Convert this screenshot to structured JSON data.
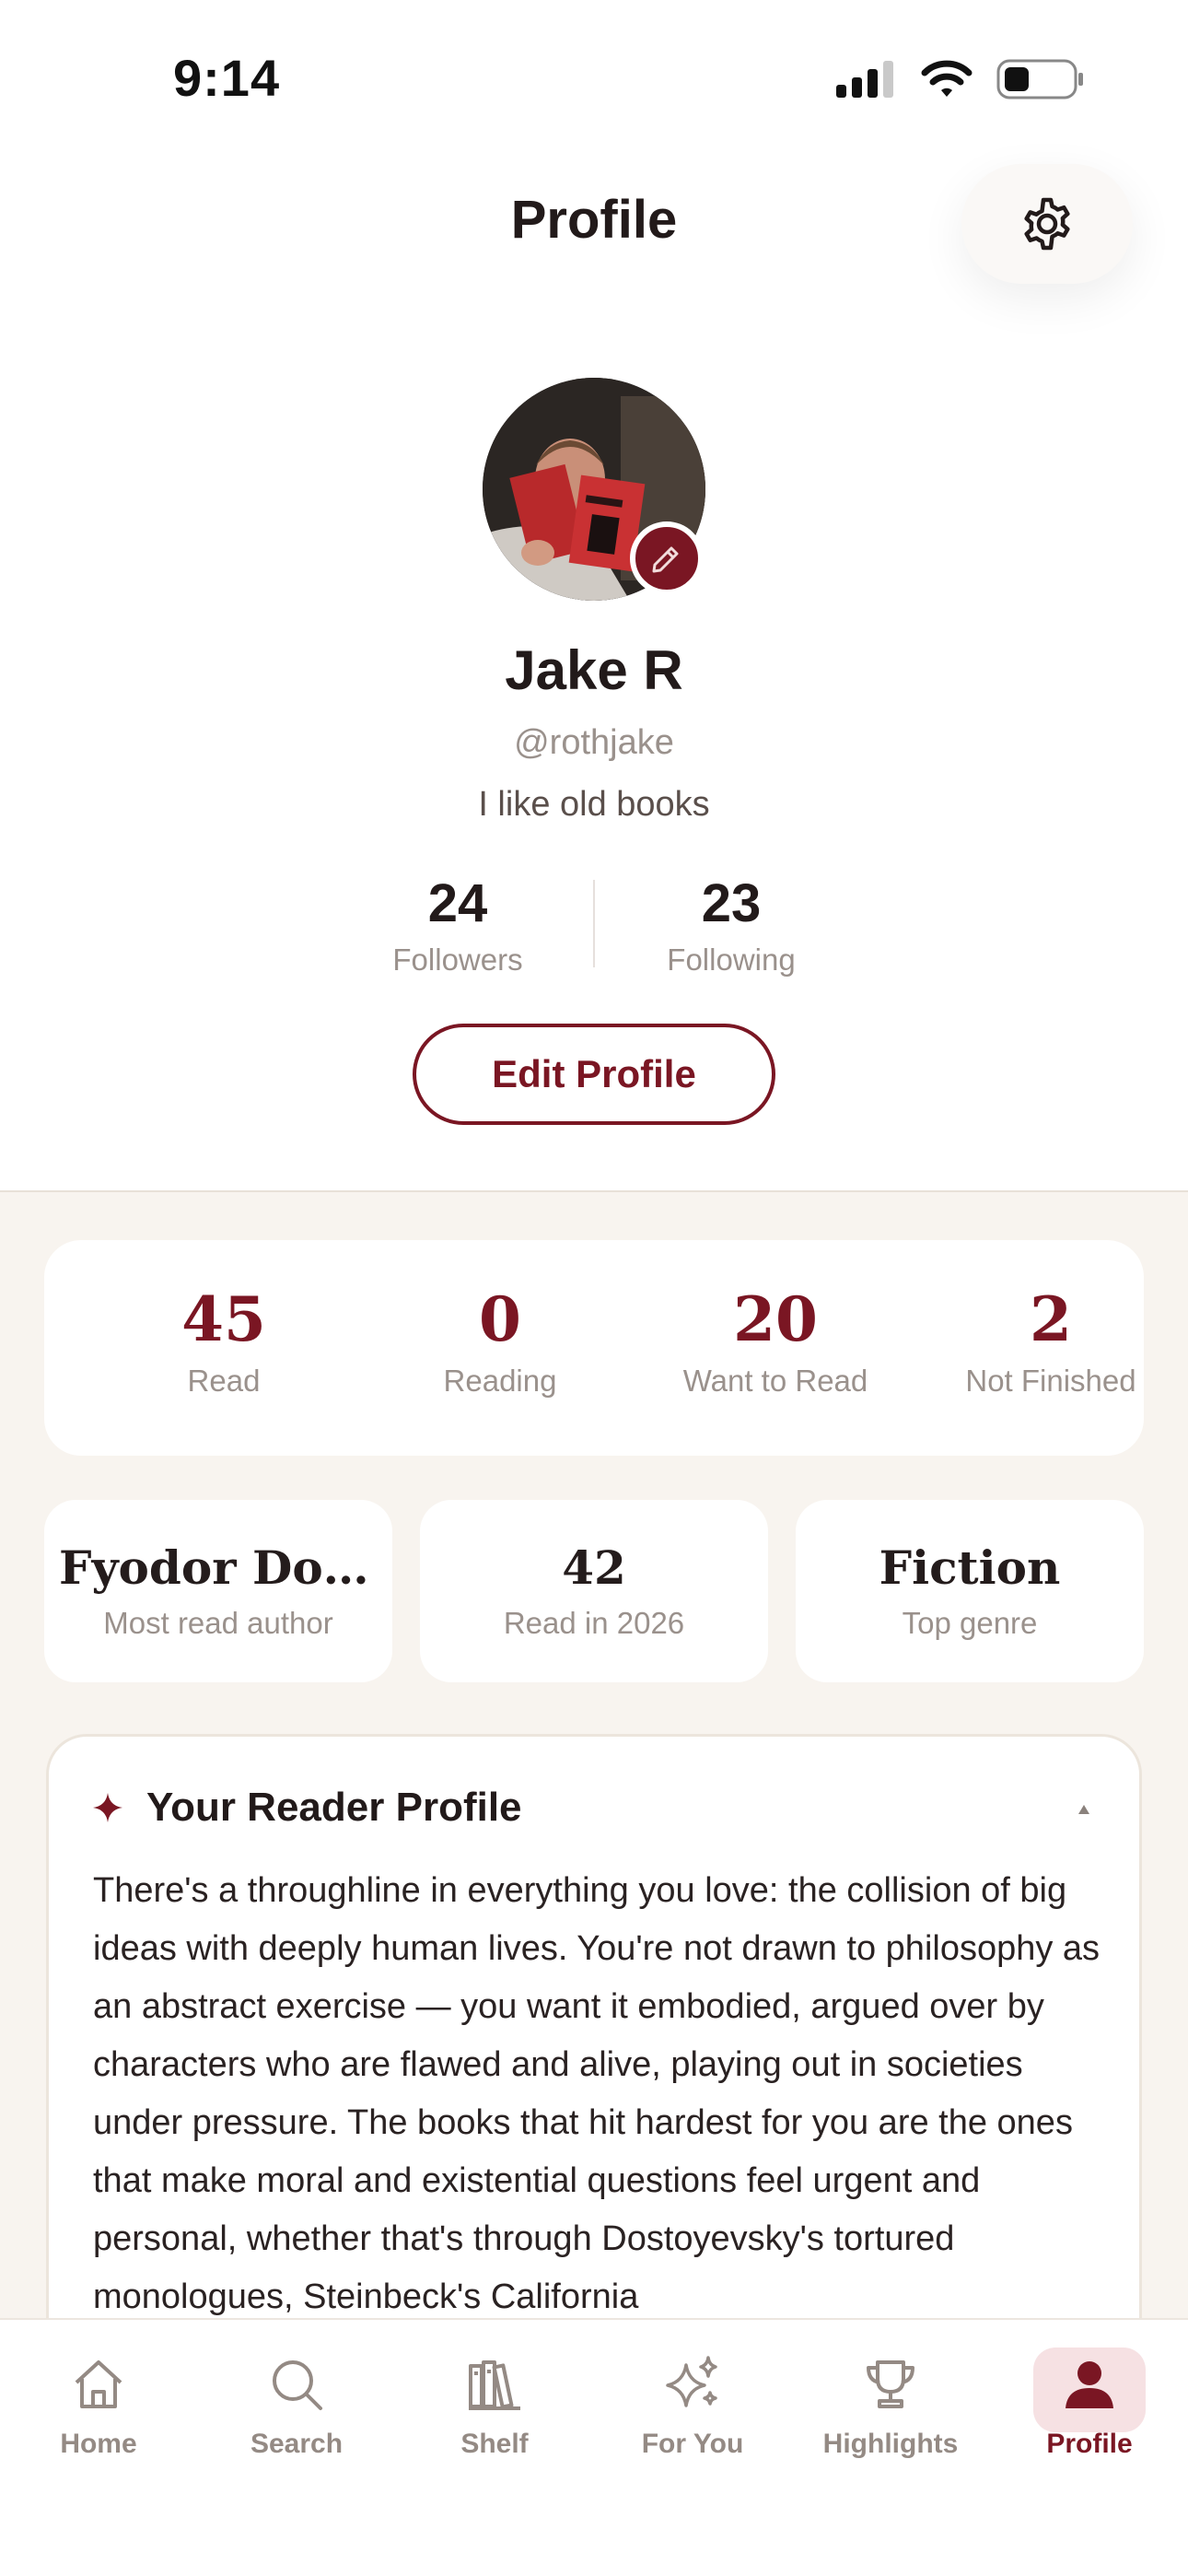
{
  "status_bar": {
    "time": "9:14"
  },
  "header": {
    "title": "Profile"
  },
  "profile": {
    "name": "Jake R",
    "handle": "@rothjake",
    "bio": "I like old books",
    "followers": {
      "count": "24",
      "label": "Followers"
    },
    "following": {
      "count": "23",
      "label": "Following"
    },
    "edit_button": "Edit Profile"
  },
  "reading_stats": [
    {
      "value": "45",
      "label": "Read"
    },
    {
      "value": "0",
      "label": "Reading"
    },
    {
      "value": "20",
      "label": "Want to Read"
    },
    {
      "value": "2",
      "label": "Not Finished"
    }
  ],
  "highlights": [
    {
      "value": "Fyodor Dost...",
      "label": "Most read author"
    },
    {
      "value": "42",
      "label": "Read in 2026"
    },
    {
      "value": "Fiction",
      "label": "Top genre"
    }
  ],
  "reader_profile": {
    "title": "Your Reader Profile",
    "body": "There's a throughline in everything you love: the collision of big ideas with deeply human lives. You're not drawn to philosophy as an abstract exercise — you want it embodied, argued over by characters who are flawed and alive, playing out in societies under pressure. The books that hit hardest for you are the ones that make moral and existential questions feel urgent and personal, whether that's through Dostoyevsky's tortured monologues, Steinbeck's California"
  },
  "tabs": [
    {
      "label": "Home",
      "icon": "home-icon"
    },
    {
      "label": "Search",
      "icon": "search-icon"
    },
    {
      "label": "Shelf",
      "icon": "shelf-icon"
    },
    {
      "label": "For You",
      "icon": "sparkles-icon"
    },
    {
      "label": "Highlights",
      "icon": "trophy-icon"
    },
    {
      "label": "Profile",
      "icon": "person-icon"
    }
  ],
  "active_tab": "Profile",
  "colors": {
    "accent": "#7a1623",
    "muted": "#9a918c",
    "section_bg": "#f8f4ef",
    "active_tab_bg": "#f6e1e3"
  }
}
